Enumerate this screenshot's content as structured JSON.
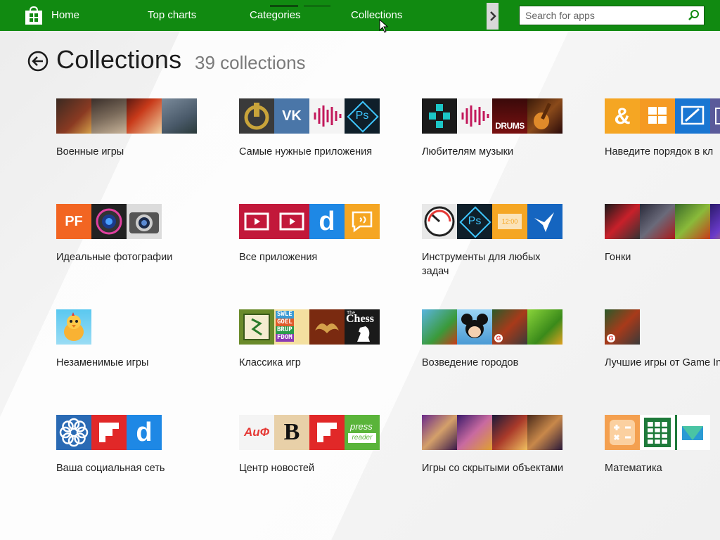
{
  "nav": {
    "items": [
      "Home",
      "Top charts",
      "Categories",
      "Collections"
    ],
    "search_placeholder": "Search for apps"
  },
  "header": {
    "title": "Collections",
    "count": "39 collections"
  },
  "collections": [
    {
      "label": "Военные игры"
    },
    {
      "label": "Самые нужные приложения"
    },
    {
      "label": "Любителям музыки"
    },
    {
      "label": "Наведите порядок в кл"
    },
    {
      "label": "Идеальные фотографии"
    },
    {
      "label": "Все приложения"
    },
    {
      "label": "Инструменты для любых задач"
    },
    {
      "label": "Гонки"
    },
    {
      "label": "Незаменимые игры"
    },
    {
      "label": "Классика игр"
    },
    {
      "label": "Возведение городов"
    },
    {
      "label": "Лучшие игры от Game Insight"
    },
    {
      "label": "Ваша социальная сеть"
    },
    {
      "label": "Центр новостей"
    },
    {
      "label": "Игры со скрытыми объектами"
    },
    {
      "label": "Математика"
    }
  ],
  "tile_text": {
    "drums": "DRUMS",
    "ps": "Ps",
    "pf": "PF",
    "chess": "Chess",
    "chess_the": "The",
    "swle": "SWLE",
    "goel": "GOEL",
    "brup": "BRUP",
    "fdom": "FDOM",
    "clock": "12:00",
    "b": "B",
    "aif": "АиФ",
    "press": "press",
    "reader": "reader",
    "d": "d",
    "amp": "&",
    "vk": "VK"
  },
  "colors": {
    "accent_green": "#118a11",
    "nav_indicator": "#0c4a0c"
  }
}
